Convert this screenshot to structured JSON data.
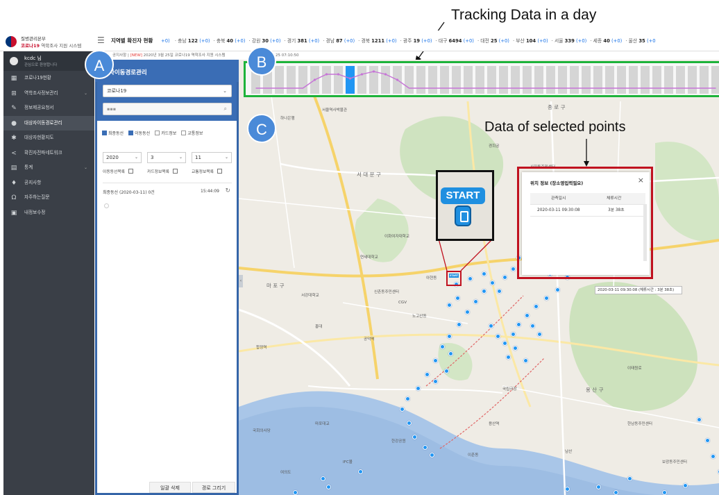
{
  "annotations": {
    "tracking_title": "Tracking Data in a day",
    "selected_title": "Data of selected points",
    "letter_a": "A",
    "letter_b": "B",
    "letter_c": "C"
  },
  "header": {
    "org_line1": "질병관리본부",
    "org_line2_brand": "코로나19",
    "org_line2_rest": "역학조사 지원 시스템",
    "menu_icon": "hamburger-icon",
    "status_title": "지역별 확진자 현황",
    "regions": [
      {
        "name": "+0)",
        "count": "",
        "inc": ""
      },
      {
        "name": "· 충남",
        "count": "122",
        "inc": "(+0)"
      },
      {
        "name": "· 충북",
        "count": "40",
        "inc": "(+0)"
      },
      {
        "name": "· 강원",
        "count": "30",
        "inc": "(+0)"
      },
      {
        "name": "· 경기",
        "count": "381",
        "inc": "(+0)"
      },
      {
        "name": "· 경남",
        "count": "87",
        "inc": "(+0)"
      },
      {
        "name": "· 경북",
        "count": "1211",
        "inc": "(+0)"
      },
      {
        "name": "· 광주",
        "count": "19",
        "inc": "(+0)"
      },
      {
        "name": "· 대구",
        "count": "6494",
        "inc": "(+0)"
      },
      {
        "name": "· 대전",
        "count": "25",
        "inc": "(+0)"
      },
      {
        "name": "· 부산",
        "count": "104",
        "inc": "(+0)"
      },
      {
        "name": "· 서울",
        "count": "339",
        "inc": "(+0)"
      },
      {
        "name": "· 세종",
        "count": "40",
        "inc": "(+0)"
      },
      {
        "name": "· 울산",
        "count": "35",
        "inc": "(+0"
      }
    ]
  },
  "sidebar": {
    "user_name": "kcdc 님",
    "user_sub": "관심으로 환영합니다",
    "items": [
      {
        "label": "코로나19현황",
        "icon": "dashboard-icon",
        "glyph": "▦"
      },
      {
        "label": "역학조사정보관리",
        "icon": "import-icon",
        "glyph": "⊞",
        "arrow": "⌄"
      },
      {
        "label": "정보제공요청서",
        "icon": "document-icon",
        "glyph": "✎"
      },
      {
        "label": "대상자이동경로관리",
        "icon": "location-pin-icon",
        "glyph": "●",
        "active": true
      },
      {
        "label": "대상자현황지도",
        "icon": "grid-map-icon",
        "glyph": "✱"
      },
      {
        "label": "확진자전파네트워크",
        "icon": "share-network-icon",
        "glyph": "<"
      },
      {
        "label": "통계",
        "icon": "chart-icon",
        "glyph": "▤",
        "arrow": "⌄"
      },
      {
        "label": "공지사항",
        "icon": "microphone-icon",
        "glyph": "♦"
      },
      {
        "label": "자주하는질문",
        "icon": "headset-icon",
        "glyph": "Ω"
      },
      {
        "label": "내정보수정",
        "icon": "profile-card-icon",
        "glyph": "▣"
      }
    ]
  },
  "notice": {
    "prefix": "공지사항 |",
    "new_tag": "[NEW]",
    "text": "2020년 3월 25일 코로나19 역학조사 지원 시스템",
    "time": "25 07:10:50"
  },
  "panel": {
    "title": "자이동경로관리",
    "disease_select": "코로나19",
    "search_value": "▪▪▪",
    "checkboxes": [
      {
        "label": "최종동선",
        "checked": true
      },
      {
        "label": "이동동선",
        "checked": true
      },
      {
        "label": "카드정보",
        "checked": false
      },
      {
        "label": "교통정보",
        "checked": false
      }
    ],
    "year": "2020",
    "month": "3",
    "day": "11",
    "links": [
      "이동동선목록",
      "카드정보목록",
      "교통정보목록"
    ],
    "latest_label": "최종동선 (2020-03-11) 0건",
    "latest_time": "15:44:09",
    "btn_delete": "일괄 삭제",
    "btn_draw": "경로 그리기"
  },
  "popup": {
    "title": "위치 정보 (장소영입력필요)",
    "col_time": "관측일시",
    "col_stay": "체류시간",
    "row_time": "2020-03-11 09:30:08",
    "row_stay": "3분 38초",
    "tooltip": "2020-03-11 09:30:08 (체류시간 : 3분 38초)"
  },
  "zoom": {
    "start": "START",
    "small_start": "START"
  },
  "map": {
    "labels": [
      {
        "t": "종 로 구",
        "c": "big"
      },
      {
        "t": "서 대 문 구",
        "c": "big"
      },
      {
        "t": "마 포 구",
        "c": "big"
      },
      {
        "t": "용 산 구",
        "c": "big"
      },
      {
        "t": "서울역사박물관",
        "c": ""
      },
      {
        "t": "이태원로",
        "c": ""
      },
      {
        "t": "하나은행",
        "c": ""
      },
      {
        "t": "마포대교",
        "c": ""
      },
      {
        "t": "서강대학교",
        "c": ""
      },
      {
        "t": "CGV",
        "c": ""
      },
      {
        "t": "홍대",
        "c": ""
      },
      {
        "t": "연세대학교",
        "c": ""
      },
      {
        "t": "이화여자대학교",
        "c": ""
      },
      {
        "t": "합정역",
        "c": ""
      },
      {
        "t": "용산역",
        "c": ""
      },
      {
        "t": "한남동주민센터",
        "c": ""
      },
      {
        "t": "남산",
        "c": ""
      },
      {
        "t": "국회의사당",
        "c": ""
      },
      {
        "t": "여의도",
        "c": ""
      },
      {
        "t": "IFC몰",
        "c": ""
      },
      {
        "t": "노고산동",
        "c": ""
      },
      {
        "t": "신촌동주민센터",
        "c": ""
      },
      {
        "t": "아현동",
        "c": ""
      },
      {
        "t": "공덕역",
        "c": ""
      },
      {
        "t": "사직동주민센터",
        "c": ""
      },
      {
        "t": "경희궁",
        "c": ""
      },
      {
        "t": "국립극장",
        "c": ""
      },
      {
        "t": "이촌동",
        "c": ""
      },
      {
        "t": "한강공원",
        "c": ""
      },
      {
        "t": "보광동주민센터",
        "c": ""
      }
    ]
  },
  "timeline": {
    "bar_count": 40,
    "selected_index": 8,
    "curve": [
      0.2,
      0.2,
      0.2,
      0.2,
      0.2,
      0.5,
      0.7,
      0.7,
      0.55,
      0.7,
      0.8,
      0.7,
      0.5,
      0.2,
      0.2,
      0.2,
      0.2,
      0.2,
      0.2,
      0.2,
      0.2,
      0.2,
      0.2,
      0.2,
      0.2,
      0.2,
      0.2,
      0.2,
      0.2,
      0.2,
      0.2,
      0.2,
      0.2,
      0.2,
      0.2,
      0.2,
      0.2,
      0.2,
      0.2,
      0.2
    ]
  },
  "colors": {
    "timeline_border": "#1db33a",
    "highlight_red": "#c0111f",
    "panel_blue": "#3a6db5",
    "selected_bar": "#2196f3",
    "curve": "#c674d6"
  }
}
